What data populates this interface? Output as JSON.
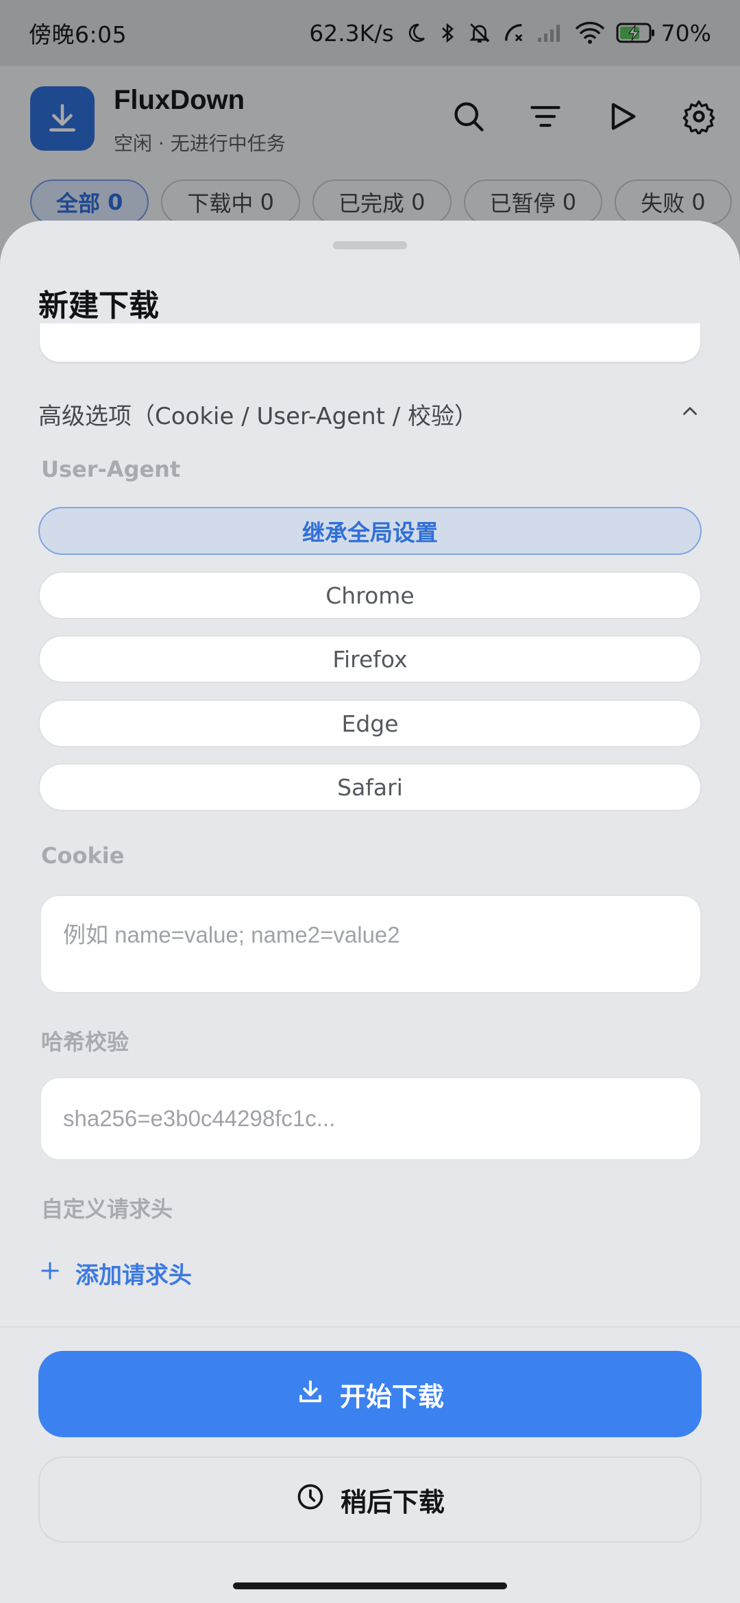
{
  "status_bar": {
    "time": "傍晚6:05",
    "network_speed": "62.3K/s",
    "battery": "70%"
  },
  "app": {
    "title": "FluxDown",
    "subtitle": "空闲 · 无进行中任务",
    "filters": [
      {
        "label": "全部",
        "count": "0"
      },
      {
        "label": "下载中",
        "count": "0"
      },
      {
        "label": "已完成",
        "count": "0"
      },
      {
        "label": "已暂停",
        "count": "0"
      },
      {
        "label": "失败",
        "count": "0"
      }
    ]
  },
  "sheet": {
    "title": "新建下载",
    "advanced_label": "高级选项（Cookie / User-Agent / 校验）",
    "user_agent": {
      "label": "User-Agent",
      "options": [
        "继承全局设置",
        "Chrome",
        "Firefox",
        "Edge",
        "Safari"
      ],
      "selected": "继承全局设置"
    },
    "cookie": {
      "label": "Cookie",
      "placeholder": "例如  name=value; name2=value2"
    },
    "hash": {
      "label": "哈希校验",
      "placeholder": "sha256=e3b0c44298fc1c..."
    },
    "custom_headers": {
      "label": "自定义请求头",
      "add_label": "添加请求头"
    },
    "start_button": "开始下载",
    "later_button": "稍后下载"
  },
  "colors": {
    "accent": "#3b82f0",
    "accent_dark": "#2f6fd8"
  }
}
